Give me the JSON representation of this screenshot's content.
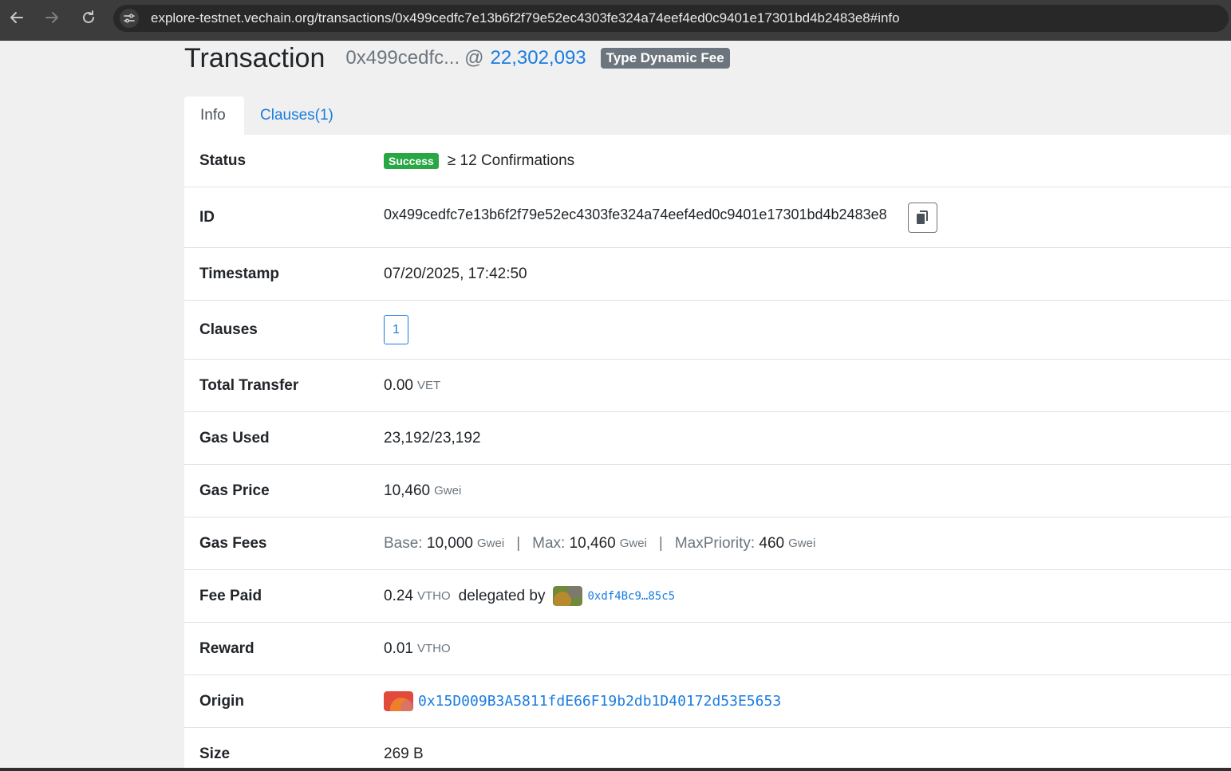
{
  "browser": {
    "url": "explore-testnet.vechain.org/transactions/0x499cedfc7e13b6f2f79e52ec4303fe324a74eef4ed0c9401e17301bd4b2483e8#info"
  },
  "header": {
    "title": "Transaction",
    "short_hash": "0x499cedfc...",
    "at": "@",
    "block_number": "22,302,093",
    "type_badge": "Type Dynamic Fee"
  },
  "tabs": [
    {
      "label": "Info"
    },
    {
      "label": "Clauses(1)"
    }
  ],
  "rows": {
    "status": {
      "label": "Status",
      "badge": "Success",
      "confirmations": "≥ 12 Confirmations"
    },
    "id": {
      "label": "ID",
      "value": "0x499cedfc7e13b6f2f79e52ec4303fe324a74eef4ed0c9401e17301bd4b2483e8"
    },
    "timestamp": {
      "label": "Timestamp",
      "value": "07/20/2025, 17:42:50"
    },
    "clauses": {
      "label": "Clauses",
      "value": "1"
    },
    "total_transfer": {
      "label": "Total Transfer",
      "value": "0.00",
      "unit": "VET"
    },
    "gas_used": {
      "label": "Gas Used",
      "value": "23,192/23,192"
    },
    "gas_price": {
      "label": "Gas Price",
      "value": "10,460",
      "unit": "Gwei"
    },
    "gas_fees": {
      "label": "Gas Fees",
      "base_label": "Base:",
      "base_value": "10,000",
      "base_unit": "Gwei",
      "max_label": "Max:",
      "max_value": "10,460",
      "max_unit": "Gwei",
      "prio_label": "MaxPriority:",
      "prio_value": "460",
      "prio_unit": "Gwei",
      "separator": "|"
    },
    "fee_paid": {
      "label": "Fee Paid",
      "value": "0.24",
      "unit": "VTHO",
      "delegated_text": "delegated by",
      "delegator": "0xdf4Bc9…85c5"
    },
    "reward": {
      "label": "Reward",
      "value": "0.01",
      "unit": "VTHO"
    },
    "origin": {
      "label": "Origin",
      "address": "0x15D009B3A5811fdE66F19b2db1D40172d53E5653"
    },
    "size": {
      "label": "Size",
      "value": "269 B"
    }
  },
  "colors": {
    "link": "#1a7ce0",
    "success": "#28a745",
    "badge_gray": "#6c757d"
  },
  "icons": [
    "back-arrow-icon",
    "forward-arrow-icon",
    "reload-icon",
    "site-info-icon",
    "copy-icon",
    "identicon"
  ]
}
